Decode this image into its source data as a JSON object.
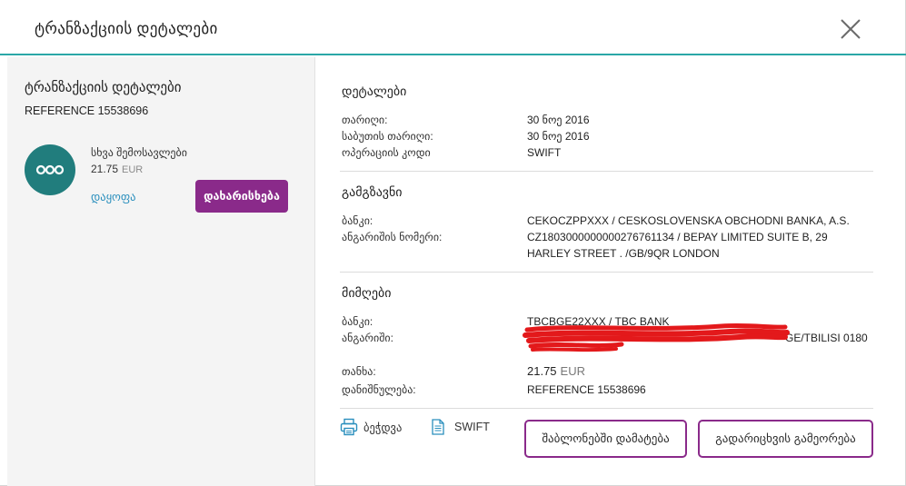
{
  "header": {
    "title": "ტრანზაქციის დეტალები"
  },
  "left": {
    "title": "ტრანზაქციის დეტალები",
    "reference": "REFERENCE 15538696",
    "category": "სხვა შემოსავლები",
    "amount": "21.75",
    "currency": "EUR",
    "split_link": "დაყოფა",
    "categorize_button": "დახარისხება"
  },
  "details": {
    "title": "დეტალები",
    "rows": [
      {
        "label": "თარიღი:",
        "value": "30 ნოე 2016"
      },
      {
        "label": "საბუთის თარიღი:",
        "value": "30 ნოე 2016"
      },
      {
        "label": "ოპერაციის კოდი",
        "value": "SWIFT"
      }
    ]
  },
  "sender": {
    "title": "გამგზავნი",
    "bank_label": "ბანკი:",
    "bank_value": "CEKOCZPPXXX / CESKOSLOVENSKA OBCHODNI BANKA, A.S.",
    "account_label": "ანგარიშის ნომერი:",
    "account_line1": "CZ1803000000000276761134 / BEPAY LIMITED SUITE B, 29",
    "account_line2": "HARLEY STREET . /GB/9QR LONDON"
  },
  "receiver": {
    "title": "მიმღები",
    "bank_label": "ბანკი:",
    "bank_value": "TBCBGE22XXX / TBC BANK",
    "account_label": "ანგარიში:",
    "account_value_visible": "GE/TBILISI 0180",
    "amount_label": "თანხა:",
    "amount_value": "21.75",
    "amount_currency": "EUR",
    "purpose_label": "დანიშნულება:",
    "purpose_value": "REFERENCE 15538696"
  },
  "actions": {
    "print": "ბეჭდვა",
    "swift": "SWIFT",
    "add_template": "შაბლონებში დამატება",
    "repeat_transfer": "გადარიცხვის გამეორება"
  },
  "colors": {
    "accent_teal": "#2aa7a7",
    "avatar_teal": "#217d7d",
    "brand_purple": "#8a2a8a",
    "link_blue": "#2a8fbd",
    "redaction_red": "#e3191b"
  },
  "icons": [
    "close-icon",
    "dots-icon",
    "printer-icon",
    "document-icon"
  ]
}
